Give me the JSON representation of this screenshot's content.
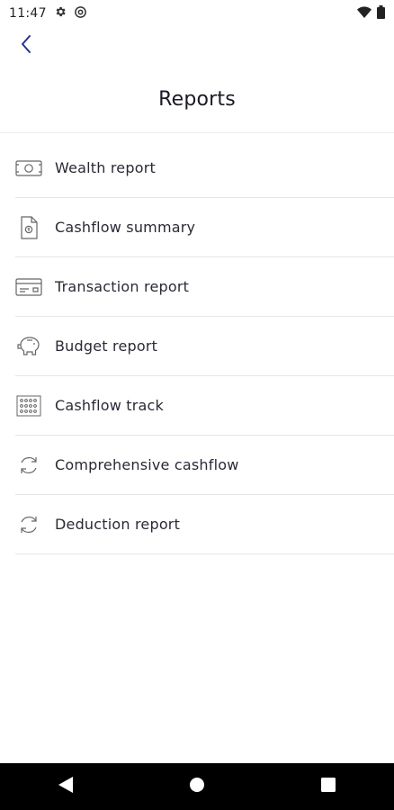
{
  "status_bar": {
    "time": "11:47"
  },
  "header": {
    "title": "Reports"
  },
  "reports": [
    {
      "label": "Wealth report",
      "icon": "banknote-icon"
    },
    {
      "label": "Cashflow summary",
      "icon": "document-icon"
    },
    {
      "label": "Transaction report",
      "icon": "card-icon"
    },
    {
      "label": "Budget report",
      "icon": "piggy-bank-icon"
    },
    {
      "label": "Cashflow track",
      "icon": "dot-grid-icon"
    },
    {
      "label": "Comprehensive cashflow",
      "icon": "refresh-icon"
    },
    {
      "label": "Deduction report",
      "icon": "refresh-icon"
    }
  ],
  "colors": {
    "accent": "#2b2f8f",
    "text": "#2a2a36",
    "divider": "#e6e6e6",
    "nav_bar": "#000000"
  }
}
